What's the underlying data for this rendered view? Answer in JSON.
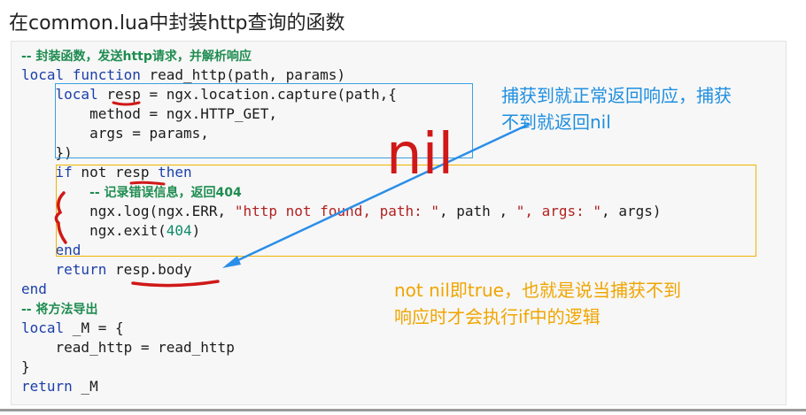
{
  "title": "在common.lua中封装http查询的函数",
  "code": [
    [
      {
        "t": "-- 封装函数，发送http请求，并解析响应",
        "c": "comment"
      }
    ],
    [
      {
        "t": "local function",
        "c": "kw"
      },
      {
        "t": " read_http(path, params)"
      }
    ],
    [
      {
        "t": "    "
      },
      {
        "t": "local",
        "c": "kw"
      },
      {
        "t": " resp = ngx.location.capture(path,{"
      }
    ],
    [
      {
        "t": "        method = ngx.HTTP_GET,"
      }
    ],
    [
      {
        "t": "        args = params,"
      }
    ],
    [
      {
        "t": "    })"
      }
    ],
    [
      {
        "t": "    "
      },
      {
        "t": "if",
        "c": "kw"
      },
      {
        "t": " not resp "
      },
      {
        "t": "then",
        "c": "kw"
      }
    ],
    [
      {
        "t": "        "
      },
      {
        "t": "-- 记录错误信息，返回404",
        "c": "comment"
      }
    ],
    [
      {
        "t": "        ngx.log(ngx.ERR, "
      },
      {
        "t": "\"http not found, path: \"",
        "c": "str"
      },
      {
        "t": ", path , "
      },
      {
        "t": "\", args: \"",
        "c": "str"
      },
      {
        "t": ", args)"
      }
    ],
    [
      {
        "t": "        ngx.exit("
      },
      {
        "t": "404",
        "c": "num"
      },
      {
        "t": ")"
      }
    ],
    [
      {
        "t": "    "
      },
      {
        "t": "end",
        "c": "kw"
      }
    ],
    [
      {
        "t": "    "
      },
      {
        "t": "return",
        "c": "kw"
      },
      {
        "t": " resp.body"
      }
    ],
    [
      {
        "t": "end",
        "c": "kw"
      }
    ],
    [
      {
        "t": "-- 将方法导出",
        "c": "comment"
      }
    ],
    [
      {
        "t": "local",
        "c": "kw"
      },
      {
        "t": " _M = {"
      }
    ],
    [
      {
        "t": "    read_http = read_http"
      }
    ],
    [
      {
        "t": "}"
      }
    ],
    [
      {
        "t": "return",
        "c": "kw"
      },
      {
        "t": " _M"
      }
    ]
  ],
  "annotations": {
    "blue_note_line1": "捕获到就正常返回响应，捕获",
    "blue_note_line2": "不到就返回nil",
    "red_nil": "nil",
    "orange_note_line1": "not nil即true，也就是说当捕获不到",
    "orange_note_line2": "响应时才会执行if中的逻辑"
  },
  "colors": {
    "blue_box": "#3ba0e0",
    "orange_box": "#f0b400",
    "red_marks": "#d01818",
    "arrow": "#2b8ee8"
  }
}
